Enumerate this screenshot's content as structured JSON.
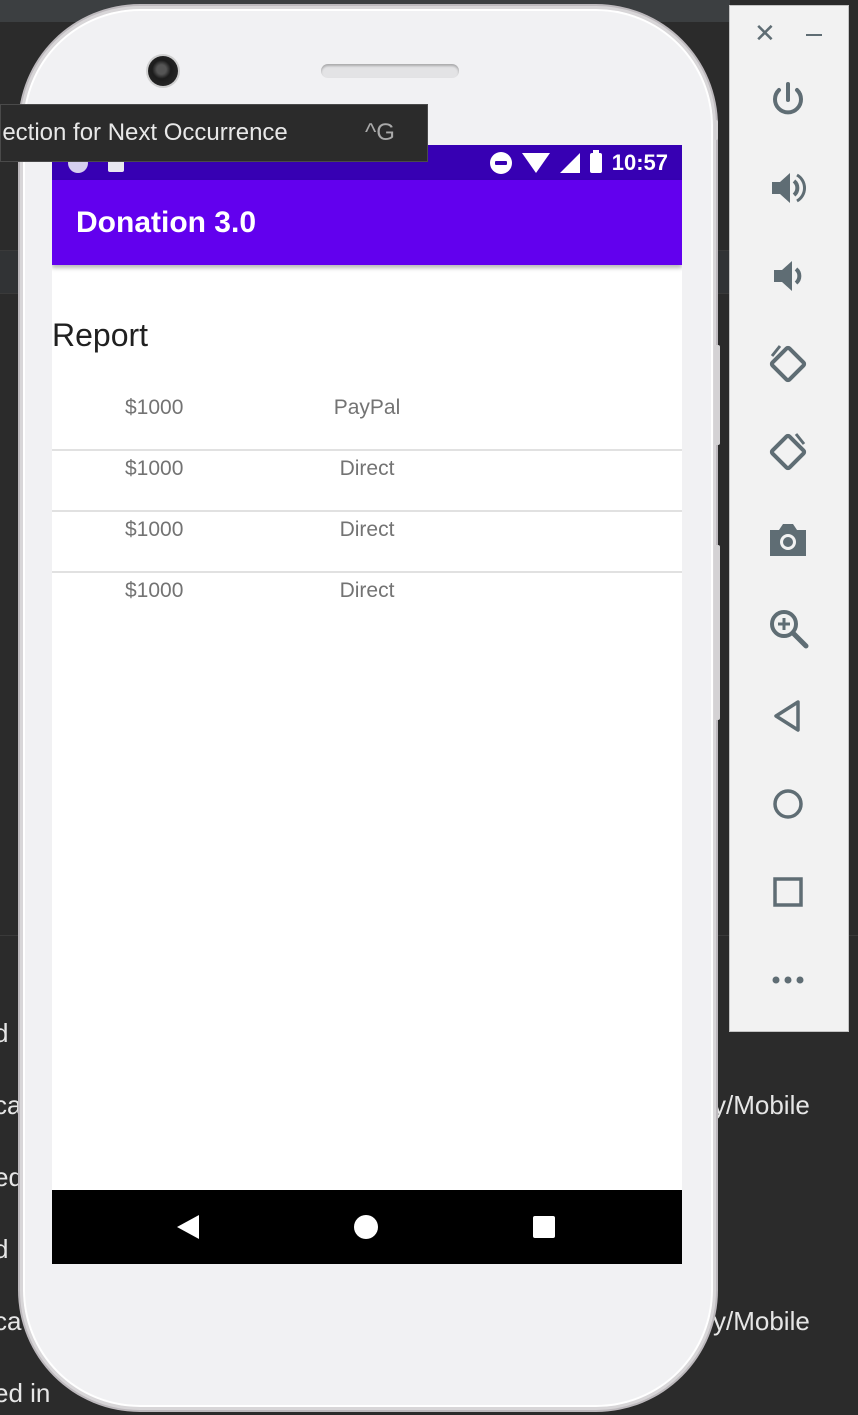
{
  "tooltip": {
    "label": "lection for Next Occurrence",
    "shortcut": "^G"
  },
  "ide_background": {
    "left_fragments": [
      "d",
      "ca",
      "ed",
      "d",
      "ca",
      "ed in"
    ],
    "right_fragments": [
      "y/Mobile",
      "y/Mobile"
    ]
  },
  "status_bar": {
    "time": "10:57"
  },
  "app_bar": {
    "title": "Donation 3.0"
  },
  "report": {
    "heading": "Report",
    "rows": [
      {
        "amount": "$1000",
        "method": "PayPal"
      },
      {
        "amount": "$1000",
        "method": "Direct"
      },
      {
        "amount": "$1000",
        "method": "Direct"
      },
      {
        "amount": "$1000",
        "method": "Direct"
      }
    ]
  },
  "navigation_bar": {
    "icons": [
      "back-icon",
      "home-icon",
      "recents-icon"
    ]
  },
  "emulator_panel": {
    "icons": [
      "close-icon",
      "minimize-icon",
      "power-icon",
      "volume-up-icon",
      "volume-down-icon",
      "rotate-left-icon",
      "rotate-right-icon",
      "camera-icon",
      "zoom-icon",
      "back-icon",
      "home-icon",
      "overview-icon",
      "more-icon"
    ]
  }
}
